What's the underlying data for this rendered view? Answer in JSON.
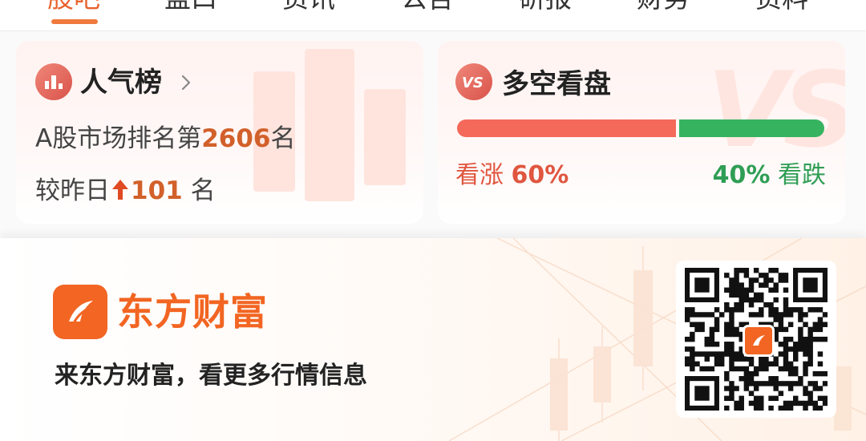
{
  "tabs": {
    "items": [
      {
        "label": "股吧",
        "active": true
      },
      {
        "label": "盘口",
        "active": false
      },
      {
        "label": "资讯",
        "active": false
      },
      {
        "label": "公告",
        "active": false
      },
      {
        "label": "研报",
        "active": false
      },
      {
        "label": "财务",
        "active": false
      },
      {
        "label": "资料",
        "active": false
      }
    ]
  },
  "popularity": {
    "icon": "bar-chart-icon",
    "title": "人气榜",
    "rank_prefix": "A股市场排名第",
    "rank_value": "2606",
    "rank_suffix": "名",
    "change_prefix": "较昨日",
    "change_direction": "up",
    "change_value": "101",
    "change_suffix": " 名"
  },
  "sentiment": {
    "icon": "vs-icon",
    "title": "多空看盘",
    "bull_label": "看涨",
    "bull_pct": "60%",
    "bull_value": 0.6,
    "bear_label": "看跌",
    "bear_pct": "40%",
    "bear_value": 0.4,
    "bull_color": "#f4695a",
    "bear_color": "#36b35f"
  },
  "promo": {
    "brand_name": "东方财富",
    "tagline": "来东方财富，看更多行情信息",
    "brand_color": "#f26522",
    "qr_icon": "qr-code-icon"
  }
}
